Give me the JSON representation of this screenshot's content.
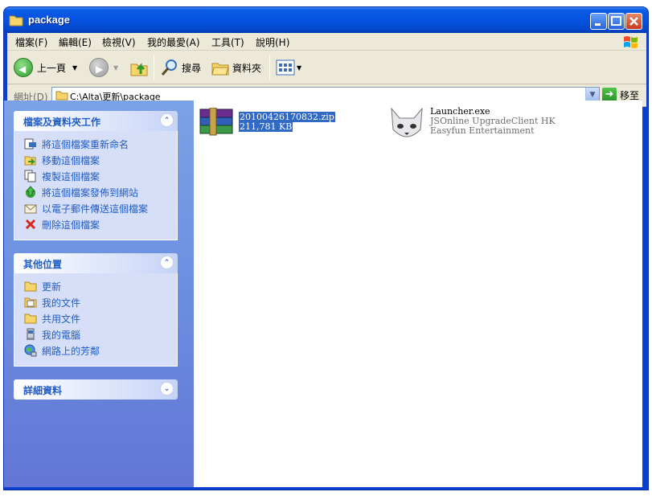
{
  "window": {
    "title": "package"
  },
  "menu": [
    {
      "label": "檔案(F)"
    },
    {
      "label": "編輯(E)"
    },
    {
      "label": "檢視(V)"
    },
    {
      "label": "我的最愛(A)"
    },
    {
      "label": "工具(T)"
    },
    {
      "label": "說明(H)"
    }
  ],
  "toolbar": {
    "back_label": "上一頁",
    "search_label": "搜尋",
    "folders_label": "資料夾"
  },
  "address": {
    "label": "網址(D)",
    "path": "C:\\Alta\\更新\\package",
    "go_label": "移至"
  },
  "taskpane": {
    "file_tasks": {
      "title": "檔案及資料夾工作",
      "items": [
        {
          "label": "將這個檔案重新命名",
          "icon": "rename-icon"
        },
        {
          "label": "移動這個檔案",
          "icon": "move-icon"
        },
        {
          "label": "複製這個檔案",
          "icon": "copy-icon"
        },
        {
          "label": "將這個檔案發佈到網站",
          "icon": "publish-icon"
        },
        {
          "label": "以電子郵件傳送這個檔案",
          "icon": "email-icon"
        },
        {
          "label": "刪除這個檔案",
          "icon": "delete-icon"
        }
      ]
    },
    "other_places": {
      "title": "其他位置",
      "items": [
        {
          "label": "更新",
          "icon": "folder-icon"
        },
        {
          "label": "我的文件",
          "icon": "my-documents-icon"
        },
        {
          "label": "共用文件",
          "icon": "shared-folder-icon"
        },
        {
          "label": "我的電腦",
          "icon": "my-computer-icon"
        },
        {
          "label": "網路上的芳鄰",
          "icon": "network-icon"
        }
      ]
    },
    "details": {
      "title": "詳細資料"
    }
  },
  "files": [
    {
      "name": "20100426170832.zip",
      "size": "211,781 KB",
      "icon": "winrar-archive-icon",
      "selected": true
    },
    {
      "name": "Launcher.exe",
      "description": "JSOnline UpgradeClient HK",
      "company": "Easyfun Entertainment",
      "icon": "cat-app-icon",
      "selected": false
    }
  ],
  "colors": {
    "titlebar": "#0553e0",
    "taskpane_bg": "#6b8fe0",
    "link": "#215dc6",
    "selection": "#316ac5"
  }
}
